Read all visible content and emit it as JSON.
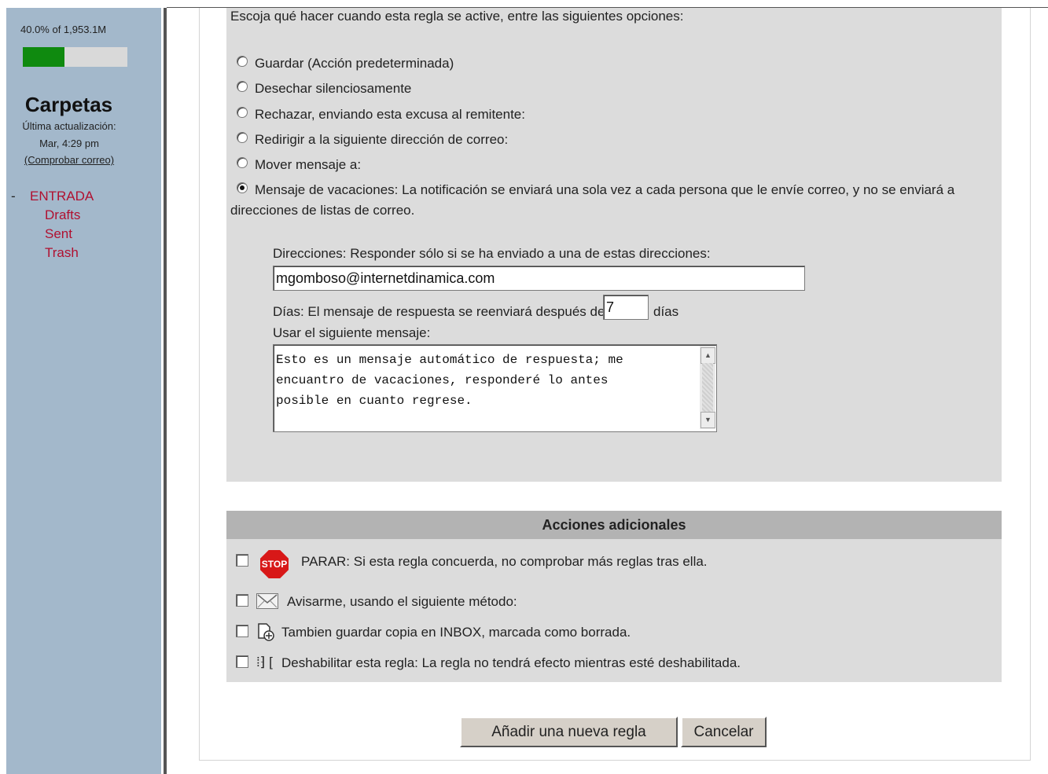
{
  "sidebar": {
    "quota_text": "40.0% of 1,953.1M",
    "quota_fraction": 0.4,
    "folders_title": "Carpetas",
    "last_update_label": "Última actualización:",
    "last_update_value": "Mar, 4:29 pm",
    "check_mail_link": "(Comprobar correo)",
    "folder_dash": "-",
    "folders": [
      "ENTRADA",
      "Drafts",
      "Sent",
      "Trash"
    ]
  },
  "rule": {
    "intro": "Escoja qué hacer cuando esta regla se active, entre las siguientes opciones:",
    "options": [
      "Guardar (Acción predeterminada)",
      "Desechar silenciosamente",
      "Rechazar, enviando esta excusa al remitente:",
      "Redirigir a la siguiente dirección de correo:",
      "Mover mensaje a:",
      "Mensaje de vacaciones: La notificación se enviará una sola vez a cada persona que le envíe correo, y no se enviará a"
    ],
    "option_continuation": "direcciones de listas de correo.",
    "selected_option": 5,
    "addresses_label": "Direcciones: Responder sólo si se ha enviado a una de estas direcciones:",
    "addresses_value": "mgomboso@internetdinamica.com",
    "days_label": "Días: El mensaje de respuesta se reenviará después de",
    "days_value": "7",
    "days_suffix": "días",
    "message_label": "Usar el siguiente mensaje:",
    "message_value": "Esto es un mensaje automático de respuesta; me\nencuantro de vacaciones, responderé lo antes\nposible en cuanto regrese."
  },
  "actions": {
    "header": "Acciones adicionales",
    "stop_icon_text": "STOP",
    "items": [
      {
        "label": "PARAR: Si esta regla concuerda, no comprobar más reglas tras ella.",
        "icon": "stop-icon",
        "checked": false
      },
      {
        "label": "Avisarme, usando el siguiente método:",
        "icon": "envelope-icon",
        "checked": false
      },
      {
        "label": "Tambien guardar copia en INBOX, marcada como borrada.",
        "icon": "copy-icon",
        "checked": false
      },
      {
        "label": "Deshabilitar esta regla: La regla no tendrá efecto mientras esté deshabilitada.",
        "icon": "disable-icon",
        "checked": false
      }
    ],
    "disable_icon_glyph": "⁞⁆ ["
  },
  "buttons": {
    "add_rule": "Añadir una nueva regla",
    "cancel": "Cancelar"
  },
  "colors": {
    "sidebar_bg": "#a3b8cb",
    "folder_link": "#b01030",
    "quota_fill": "#0f8a0f",
    "panel_gray": "#dcdcdc"
  }
}
